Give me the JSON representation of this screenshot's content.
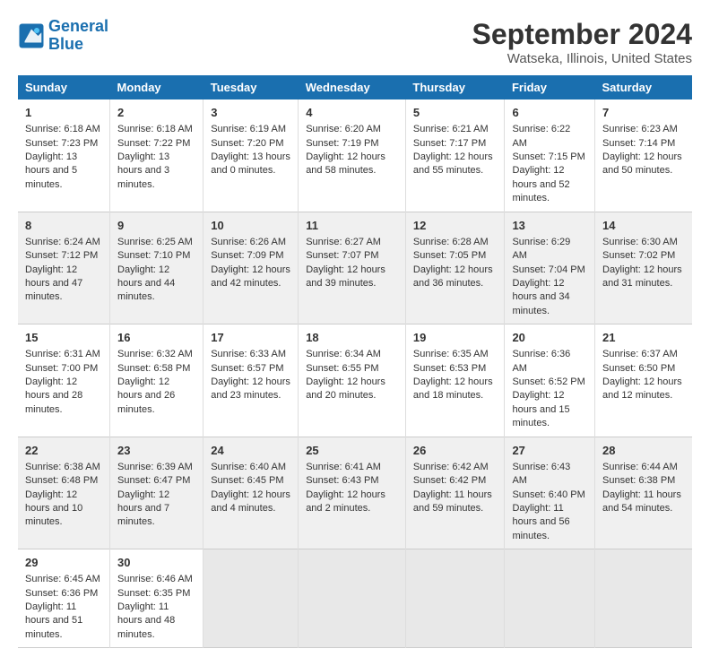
{
  "header": {
    "logo_line1": "General",
    "logo_line2": "Blue",
    "title": "September 2024",
    "subtitle": "Watseka, Illinois, United States"
  },
  "columns": [
    "Sunday",
    "Monday",
    "Tuesday",
    "Wednesday",
    "Thursday",
    "Friday",
    "Saturday"
  ],
  "weeks": [
    [
      {
        "day": "1",
        "sunrise": "6:18 AM",
        "sunset": "7:23 PM",
        "daylight": "13 hours and 5 minutes."
      },
      {
        "day": "2",
        "sunrise": "6:18 AM",
        "sunset": "7:22 PM",
        "daylight": "13 hours and 3 minutes."
      },
      {
        "day": "3",
        "sunrise": "6:19 AM",
        "sunset": "7:20 PM",
        "daylight": "13 hours and 0 minutes."
      },
      {
        "day": "4",
        "sunrise": "6:20 AM",
        "sunset": "7:19 PM",
        "daylight": "12 hours and 58 minutes."
      },
      {
        "day": "5",
        "sunrise": "6:21 AM",
        "sunset": "7:17 PM",
        "daylight": "12 hours and 55 minutes."
      },
      {
        "day": "6",
        "sunrise": "6:22 AM",
        "sunset": "7:15 PM",
        "daylight": "12 hours and 52 minutes."
      },
      {
        "day": "7",
        "sunrise": "6:23 AM",
        "sunset": "7:14 PM",
        "daylight": "12 hours and 50 minutes."
      }
    ],
    [
      {
        "day": "8",
        "sunrise": "6:24 AM",
        "sunset": "7:12 PM",
        "daylight": "12 hours and 47 minutes."
      },
      {
        "day": "9",
        "sunrise": "6:25 AM",
        "sunset": "7:10 PM",
        "daylight": "12 hours and 44 minutes."
      },
      {
        "day": "10",
        "sunrise": "6:26 AM",
        "sunset": "7:09 PM",
        "daylight": "12 hours and 42 minutes."
      },
      {
        "day": "11",
        "sunrise": "6:27 AM",
        "sunset": "7:07 PM",
        "daylight": "12 hours and 39 minutes."
      },
      {
        "day": "12",
        "sunrise": "6:28 AM",
        "sunset": "7:05 PM",
        "daylight": "12 hours and 36 minutes."
      },
      {
        "day": "13",
        "sunrise": "6:29 AM",
        "sunset": "7:04 PM",
        "daylight": "12 hours and 34 minutes."
      },
      {
        "day": "14",
        "sunrise": "6:30 AM",
        "sunset": "7:02 PM",
        "daylight": "12 hours and 31 minutes."
      }
    ],
    [
      {
        "day": "15",
        "sunrise": "6:31 AM",
        "sunset": "7:00 PM",
        "daylight": "12 hours and 28 minutes."
      },
      {
        "day": "16",
        "sunrise": "6:32 AM",
        "sunset": "6:58 PM",
        "daylight": "12 hours and 26 minutes."
      },
      {
        "day": "17",
        "sunrise": "6:33 AM",
        "sunset": "6:57 PM",
        "daylight": "12 hours and 23 minutes."
      },
      {
        "day": "18",
        "sunrise": "6:34 AM",
        "sunset": "6:55 PM",
        "daylight": "12 hours and 20 minutes."
      },
      {
        "day": "19",
        "sunrise": "6:35 AM",
        "sunset": "6:53 PM",
        "daylight": "12 hours and 18 minutes."
      },
      {
        "day": "20",
        "sunrise": "6:36 AM",
        "sunset": "6:52 PM",
        "daylight": "12 hours and 15 minutes."
      },
      {
        "day": "21",
        "sunrise": "6:37 AM",
        "sunset": "6:50 PM",
        "daylight": "12 hours and 12 minutes."
      }
    ],
    [
      {
        "day": "22",
        "sunrise": "6:38 AM",
        "sunset": "6:48 PM",
        "daylight": "12 hours and 10 minutes."
      },
      {
        "day": "23",
        "sunrise": "6:39 AM",
        "sunset": "6:47 PM",
        "daylight": "12 hours and 7 minutes."
      },
      {
        "day": "24",
        "sunrise": "6:40 AM",
        "sunset": "6:45 PM",
        "daylight": "12 hours and 4 minutes."
      },
      {
        "day": "25",
        "sunrise": "6:41 AM",
        "sunset": "6:43 PM",
        "daylight": "12 hours and 2 minutes."
      },
      {
        "day": "26",
        "sunrise": "6:42 AM",
        "sunset": "6:42 PM",
        "daylight": "11 hours and 59 minutes."
      },
      {
        "day": "27",
        "sunrise": "6:43 AM",
        "sunset": "6:40 PM",
        "daylight": "11 hours and 56 minutes."
      },
      {
        "day": "28",
        "sunrise": "6:44 AM",
        "sunset": "6:38 PM",
        "daylight": "11 hours and 54 minutes."
      }
    ],
    [
      {
        "day": "29",
        "sunrise": "6:45 AM",
        "sunset": "6:36 PM",
        "daylight": "11 hours and 51 minutes."
      },
      {
        "day": "30",
        "sunrise": "6:46 AM",
        "sunset": "6:35 PM",
        "daylight": "11 hours and 48 minutes."
      },
      null,
      null,
      null,
      null,
      null
    ]
  ],
  "labels": {
    "sunrise": "Sunrise:",
    "sunset": "Sunset:",
    "daylight": "Daylight:"
  }
}
